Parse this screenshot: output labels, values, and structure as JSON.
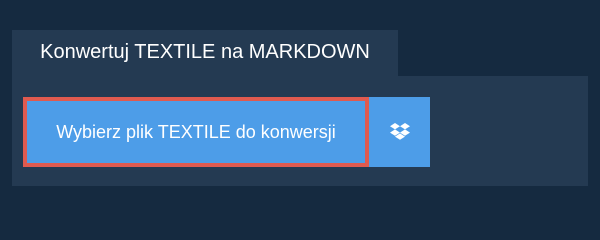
{
  "tab": {
    "label": "Konwertuj TEXTILE na MARKDOWN"
  },
  "upload": {
    "choose_file_label": "Wybierz plik TEXTILE do konwersji",
    "dropbox_icon": "dropbox-icon"
  },
  "colors": {
    "background": "#152a40",
    "panel": "#243a52",
    "button": "#4d9de8",
    "highlight_border": "#e05a4f"
  }
}
